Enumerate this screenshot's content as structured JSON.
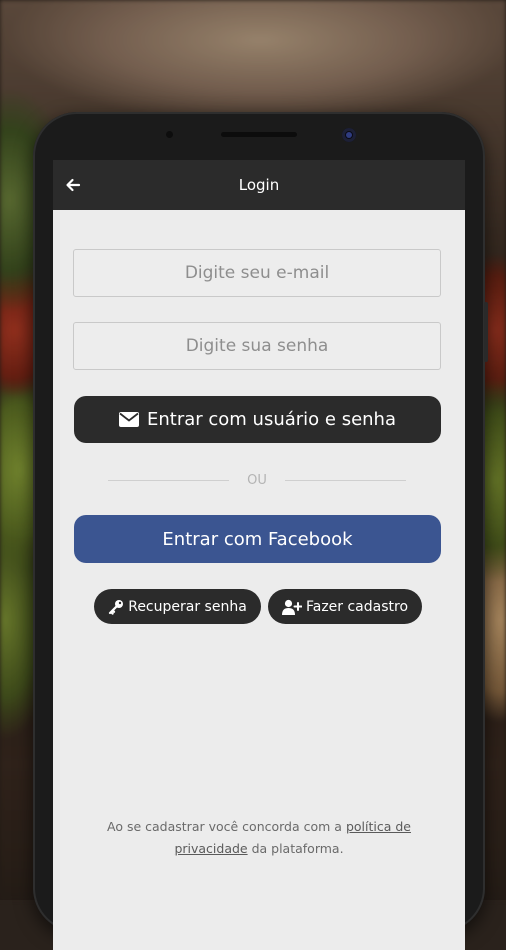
{
  "app_bar": {
    "title": "Login",
    "back_icon": "arrow-left-icon"
  },
  "form": {
    "email_placeholder": "Digite seu e-mail",
    "email_value": "",
    "password_placeholder": "Digite sua senha",
    "password_value": "",
    "login_button_label": "Entrar com usuário e senha",
    "login_button_icon": "envelope-icon",
    "divider_label": "OU",
    "facebook_button_label": "Entrar com Facebook"
  },
  "actions": {
    "recover_label": "Recuperar senha",
    "recover_icon": "key-icon",
    "signup_label": "Fazer cadastro",
    "signup_icon": "user-plus-icon"
  },
  "terms": {
    "prefix": "Ao se cadastrar você concorda com a ",
    "link_text": "política de privacidade",
    "suffix": " da plataforma."
  },
  "colors": {
    "app_bar": "#2b2b2b",
    "screen_background": "#ececec",
    "dark_button": "#2b2b2b",
    "facebook_button": "#3b5591"
  }
}
